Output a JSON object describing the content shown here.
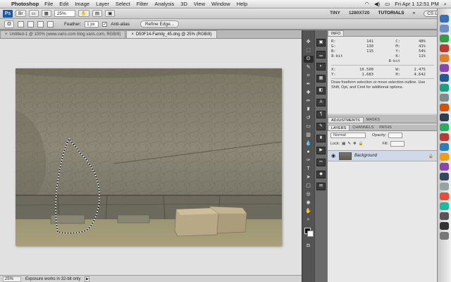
{
  "menubar": {
    "app": "Photoshop",
    "items": [
      "File",
      "Edit",
      "Image",
      "Layer",
      "Select",
      "Filter",
      "Analysis",
      "3D",
      "View",
      "Window",
      "Help"
    ],
    "clock": "Fri Apr 1  12:51 PM"
  },
  "appbar": {
    "logo": "Ps",
    "zoom": "25%",
    "workspaces": [
      "TINY",
      "1280X720",
      "TUTORIALS"
    ],
    "cslive": "CS Live"
  },
  "options": {
    "feather_label": "Feather:",
    "feather_value": "1 px",
    "antialias_label": "Anti-alias",
    "refine_label": "Refine Edge..."
  },
  "tabs": [
    {
      "label": "Untitled-1 @ 100% (www.varis.com blog.varis.com, RGB/8)",
      "active": false
    },
    {
      "label": "D50F14-Family_45.dng @ 25% (RGB/8)",
      "active": true
    }
  ],
  "status": {
    "zoom": "25%",
    "message": "Exposure works in 32-bit only"
  },
  "info_panel": {
    "tab": "INFO",
    "rgb": {
      "R": "141",
      "G": "130",
      "B": "115"
    },
    "cmyk": {
      "C": "48%",
      "M": "41%",
      "Y": "54%",
      "K": "11%"
    },
    "bit_left": "8-bit",
    "bit_right": "8-bit",
    "xy": {
      "X": "10.500",
      "Y": "1.683"
    },
    "wh": {
      "W": "2.475",
      "H": "4.642"
    },
    "hint": "Draw freeform selection or move selection outline.  Use Shift, Opt, and Cmd for additional options."
  },
  "adjust_tabs": [
    "ADJUSTMENTS",
    "MASKS"
  ],
  "layers_panel": {
    "tabs": [
      "LAYERS",
      "CHANNELS",
      "PATHS"
    ],
    "blend_mode": "Normal",
    "opacity_label": "Opacity:",
    "lock_label": "Lock:",
    "fill_label": "Fill:",
    "layer_name": "Background"
  },
  "colors": {
    "accent": "#1f5a9e",
    "panel_dark": "#535353",
    "canvas_bg": "#e1e1e1"
  }
}
